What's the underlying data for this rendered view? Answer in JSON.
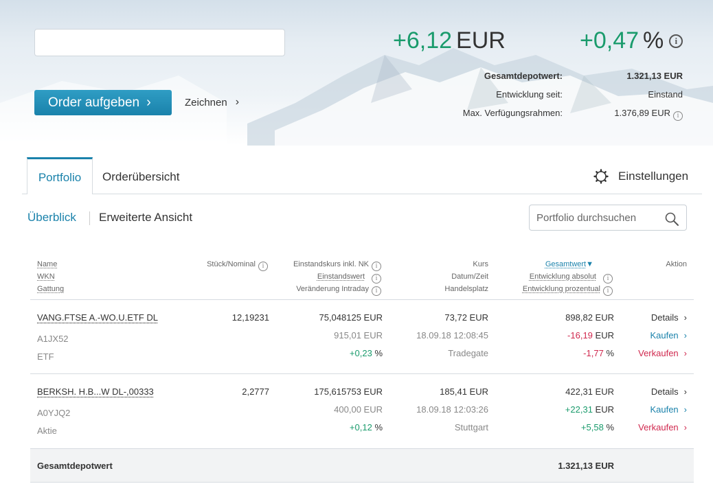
{
  "hero": {
    "search_value": "",
    "order_button": "Order aufgeben",
    "zeichnen_link": "Zeichnen",
    "change_abs_value": "+6,12",
    "change_abs_unit": "EUR",
    "change_pct_value": "+0,47",
    "change_pct_unit": "%",
    "summary": {
      "gesamt_label": "Gesamtdepotwert:",
      "gesamt_value": "1.321,13 EUR",
      "entwicklung_label": "Entwicklung seit:",
      "entwicklung_value": "Einstand",
      "max_label": "Max. Verfügungsrahmen:",
      "max_value": "1.376,89 EUR"
    }
  },
  "tabs": {
    "portfolio": "Portfolio",
    "orders": "Orderübersicht",
    "settings": "Einstellungen"
  },
  "view": {
    "overview": "Überblick",
    "extended": "Erweiterte Ansicht",
    "search_placeholder": "Portfolio durchsuchen"
  },
  "table": {
    "headers": {
      "name": "Name",
      "wkn": "WKN",
      "gattung": "Gattung",
      "stueck": "Stück/Nominal",
      "einstandskurs": "Einstandskurs inkl. NK",
      "einstandswert": "Einstandswert",
      "veraenderung": "Veränderung Intraday",
      "kurs": "Kurs",
      "datum": "Datum/Zeit",
      "handelsplatz": "Handelsplatz",
      "gesamtwert": "Gesamtwert",
      "sort_indicator": "▼",
      "entw_abs": "Entwicklung absolut",
      "entw_pct": "Entwicklung prozentual",
      "aktion": "Aktion"
    },
    "rows": [
      {
        "name": "VANG.FTSE A.-WO.U.ETF DL",
        "wkn": "A1JX52",
        "gattung": "ETF",
        "stueck": "12,19231",
        "einstandskurs": "75,048125 EUR",
        "einstandswert": "915,01 EUR",
        "veraenderung_value": "+0,23",
        "veraenderung_unit": "%",
        "kurs": "73,72 EUR",
        "datum": "18.09.18 12:08:45",
        "handelsplatz": "Tradegate",
        "gesamtwert": "898,82 EUR",
        "entw_abs_value": "-16,19",
        "entw_abs_unit": "EUR",
        "entw_pct_value": "-1,77",
        "entw_pct_unit": "%",
        "action_details": "Details",
        "action_buy": "Kaufen",
        "action_sell": "Verkaufen"
      },
      {
        "name": "BERKSH. H.B...W DL-,00333",
        "wkn": "A0YJQ2",
        "gattung": "Aktie",
        "stueck": "2,2777",
        "einstandskurs": "175,615753 EUR",
        "einstandswert": "400,00 EUR",
        "veraenderung_value": "+0,12",
        "veraenderung_unit": "%",
        "kurs": "185,41 EUR",
        "datum": "18.09.18 12:03:26",
        "handelsplatz": "Stuttgart",
        "gesamtwert": "422,31 EUR",
        "entw_abs_value": "+22,31",
        "entw_abs_unit": "EUR",
        "entw_pct_value": "+5,58",
        "entw_pct_unit": "%",
        "action_details": "Details",
        "action_buy": "Kaufen",
        "action_sell": "Verkaufen"
      }
    ],
    "total": {
      "label": "Gesamtdepotwert",
      "value": "1.321,13 EUR"
    }
  },
  "colors": {
    "accent": "#1a82ab",
    "positive": "#1a9b6c",
    "negative": "#d0284e"
  },
  "icons": [
    "chevron-right-icon",
    "info-icon",
    "gear-icon",
    "search-icon"
  ]
}
